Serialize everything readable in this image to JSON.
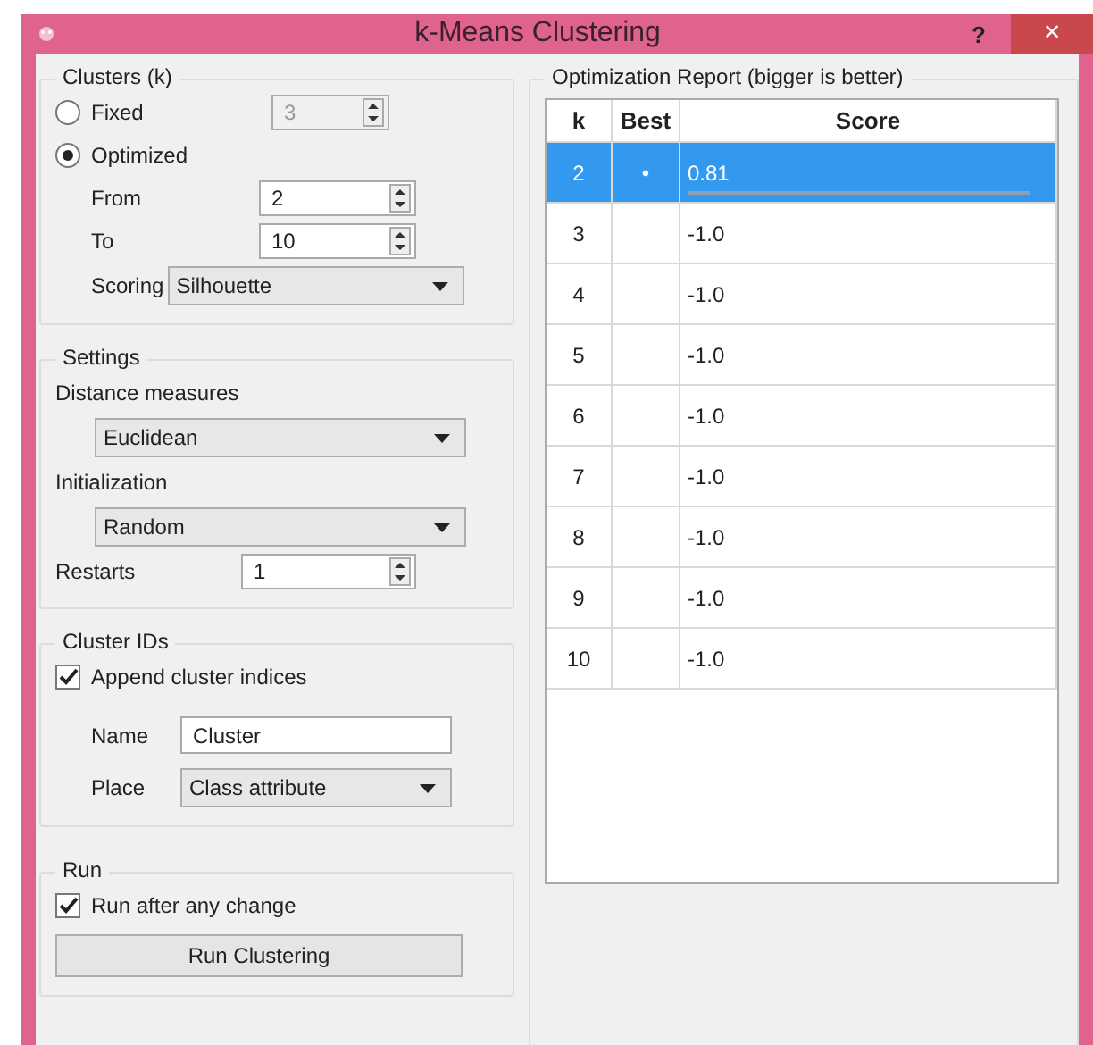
{
  "window": {
    "title": "k-Means Clustering",
    "help": "?",
    "close": "×"
  },
  "clusters": {
    "title": "Clusters (k)",
    "options": [
      {
        "label": "Fixed",
        "selected": false,
        "value": "3",
        "disabled": true
      },
      {
        "label": "Optimized",
        "selected": true
      }
    ],
    "from": {
      "label": "From",
      "value": "2"
    },
    "to": {
      "label": "To",
      "value": "10"
    },
    "scoring": {
      "label": "Scoring",
      "value": "Silhouette"
    }
  },
  "settings": {
    "title": "Settings",
    "distance": {
      "label": "Distance measures",
      "value": "Euclidean"
    },
    "initialization": {
      "label": "Initialization",
      "value": "Random"
    },
    "restarts": {
      "label": "Restarts",
      "value": "1"
    }
  },
  "cluster_ids": {
    "title": "Cluster IDs",
    "append": {
      "label": "Append cluster indices",
      "checked": true
    },
    "name": {
      "label": "Name",
      "value": "Cluster"
    },
    "place": {
      "label": "Place",
      "value": "Class attribute"
    }
  },
  "run": {
    "title": "Run",
    "auto": {
      "label": "Run after any change",
      "checked": true
    },
    "button": "Run Clustering"
  },
  "report": {
    "title": "Optimization Report (bigger is better)",
    "columns": [
      "k",
      "Best",
      "Score"
    ],
    "rows": [
      {
        "k": "2",
        "best": "•",
        "score": "0.81",
        "selected": true,
        "level": 0.95
      },
      {
        "k": "3",
        "score": "-1.0",
        "selected": false
      },
      {
        "k": "4",
        "score": "-1.0",
        "selected": false
      },
      {
        "k": "5",
        "score": "-1.0",
        "selected": false
      },
      {
        "k": "6",
        "score": "-1.0",
        "selected": false
      },
      {
        "k": "7",
        "score": "-1.0",
        "selected": false
      },
      {
        "k": "8",
        "score": "-1.0",
        "selected": false
      },
      {
        "k": "9",
        "score": "-1.0",
        "selected": false
      },
      {
        "k": "10",
        "score": "-1.0",
        "selected": false
      }
    ]
  }
}
